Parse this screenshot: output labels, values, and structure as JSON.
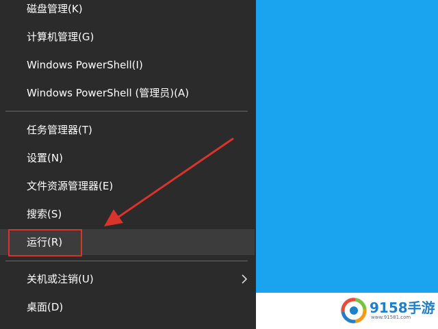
{
  "menu": {
    "items": [
      {
        "label": "磁盘管理(K)",
        "has_submenu": false,
        "highlighted": false
      },
      {
        "label": "计算机管理(G)",
        "has_submenu": false,
        "highlighted": false
      },
      {
        "label": "Windows PowerShell(I)",
        "has_submenu": false,
        "highlighted": false
      },
      {
        "label": "Windows PowerShell (管理员)(A)",
        "has_submenu": false,
        "highlighted": false
      },
      {
        "label": "任务管理器(T)",
        "has_submenu": false,
        "highlighted": false
      },
      {
        "label": "设置(N)",
        "has_submenu": false,
        "highlighted": false
      },
      {
        "label": "文件资源管理器(E)",
        "has_submenu": false,
        "highlighted": false
      },
      {
        "label": "搜索(S)",
        "has_submenu": false,
        "highlighted": false
      },
      {
        "label": "运行(R)",
        "has_submenu": false,
        "highlighted": true
      },
      {
        "label": "关机或注销(U)",
        "has_submenu": true,
        "highlighted": false
      },
      {
        "label": "桌面(D)",
        "has_submenu": false,
        "highlighted": false
      }
    ]
  },
  "annotation": {
    "color": "#d9342b",
    "target": "运行(R)"
  },
  "colors": {
    "menu_background": "#2b2b2b",
    "menu_text": "#ffffff",
    "menu_highlight": "#3c3c3c",
    "desktop": "#1aa3ee"
  },
  "watermark": {
    "brand": "9158手游",
    "url": "www.91581.com"
  }
}
